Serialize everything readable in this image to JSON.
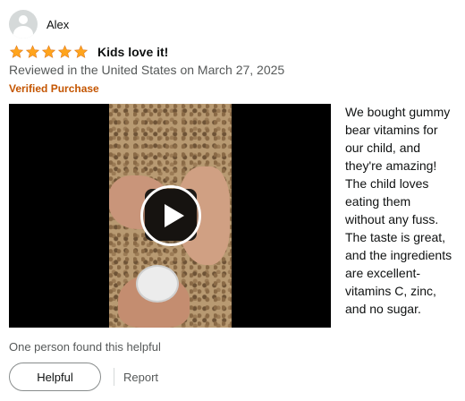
{
  "reviewer": {
    "name": "Alex",
    "avatar_icon": "user-silhouette-icon"
  },
  "review": {
    "rating": 5,
    "rating_max": 5,
    "star_color": "#ffa41c",
    "title": "Kids love it!",
    "date_line": "Reviewed in the United States on March 27, 2025",
    "verified_label": "Verified Purchase",
    "body_lines": [
      "We bought gummy",
      "bear vitamins for",
      "our child, and",
      "they're amazing!",
      "The child loves",
      "eating them",
      "without any fuss.",
      "The taste is great,",
      "and the ingredients",
      "are excellent-",
      "vitamins C, zinc,",
      "and no sugar."
    ]
  },
  "video": {
    "play_icon": "play-icon"
  },
  "feedback": {
    "helpful_count_text": "One person found this helpful",
    "helpful_button_label": "Helpful",
    "report_label": "Report"
  }
}
